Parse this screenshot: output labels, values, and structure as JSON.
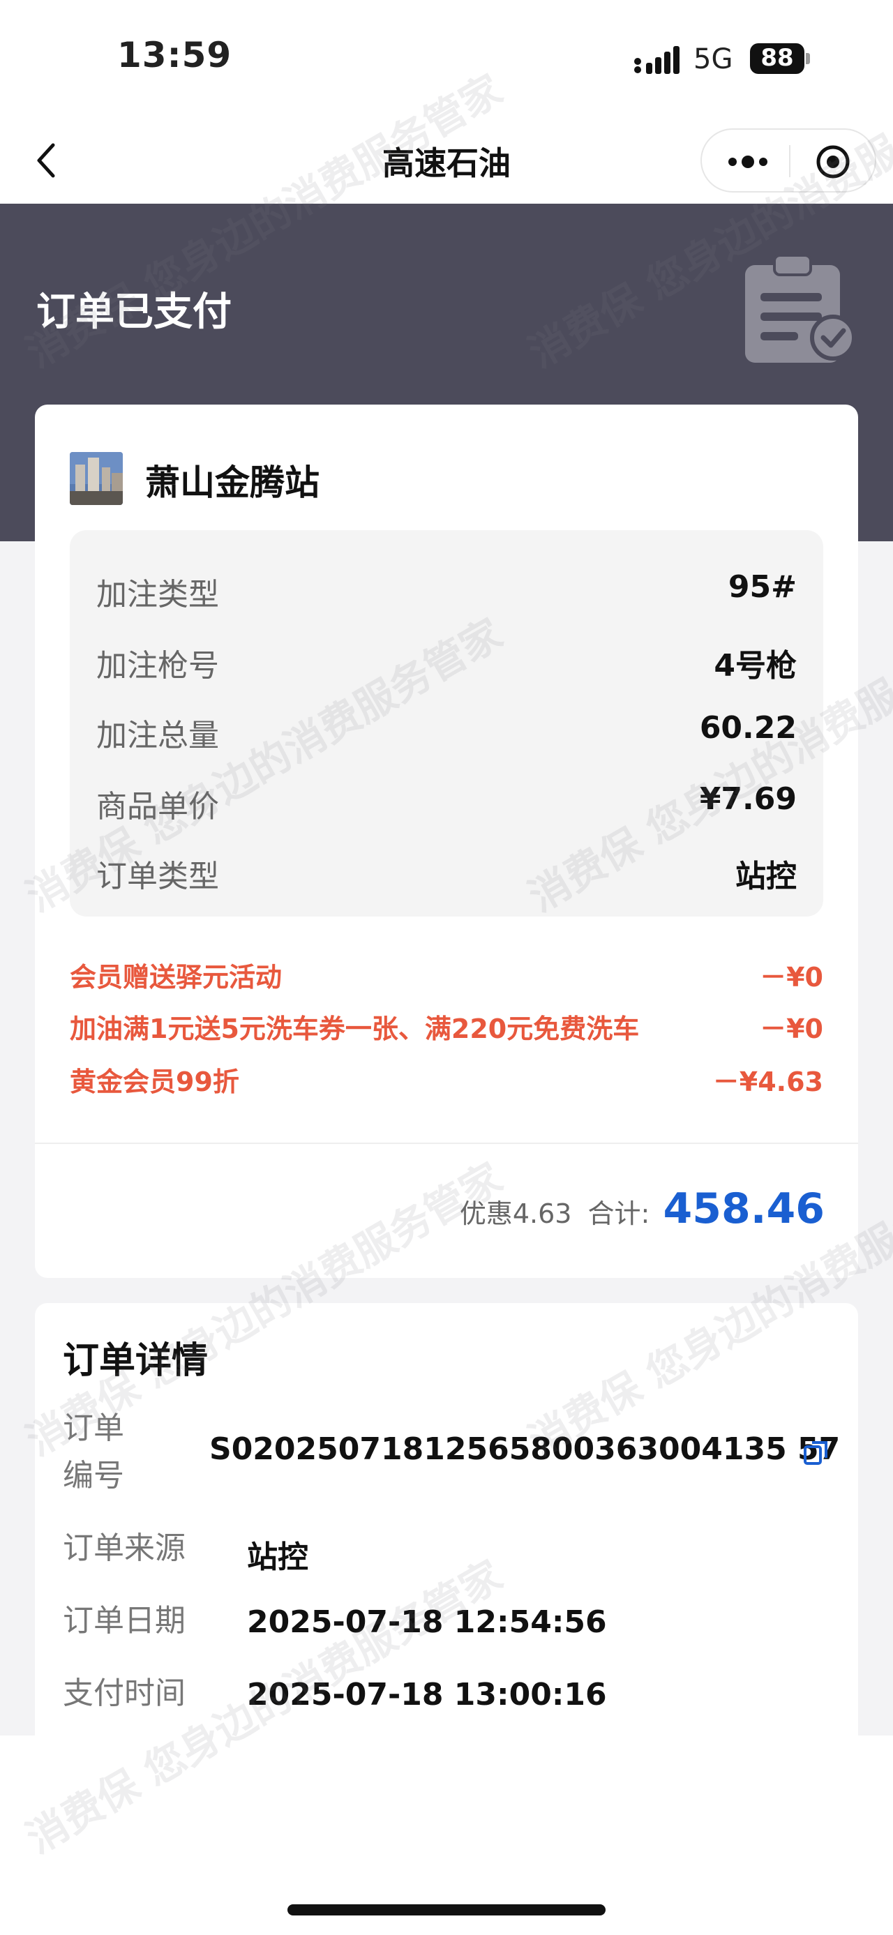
{
  "status_bar": {
    "time": "13:59",
    "network": "5G",
    "battery": "88"
  },
  "nav": {
    "title": "高速石油"
  },
  "header": {
    "status_title": "订单已支付"
  },
  "order": {
    "station_name": "萧山金腾站",
    "info_rows": [
      {
        "label": "加注类型",
        "value": "95#"
      },
      {
        "label": "加注枪号",
        "value": "4号枪"
      },
      {
        "label": "加注总量",
        "value": "60.22"
      },
      {
        "label": "商品单价",
        "value": "¥7.69"
      },
      {
        "label": "订单类型",
        "value": "站控"
      }
    ],
    "promotions": [
      {
        "label": "会员赠送驿元活动",
        "value": "－¥0"
      },
      {
        "label": "加油满1元送5元洗车券一张、满220元免费洗车",
        "value": "－¥0"
      },
      {
        "label": "黄金会员99折",
        "value": "－¥4.63"
      }
    ],
    "discount_text": "优惠4.63",
    "total_label": "合计:",
    "total_value": "458.46"
  },
  "details": {
    "title": "订单详情",
    "order_no_label": "订单编号",
    "order_no": "S02025071812565800363004135 57",
    "rows": [
      {
        "label": "订单来源",
        "value": "站控"
      },
      {
        "label": "订单日期",
        "value": "2025-07-18 12:54:56"
      },
      {
        "label": "支付时间",
        "value": "2025-07-18 13:00:16"
      }
    ]
  },
  "watermark": {
    "text": "消费保 您身边的消费服务管家"
  },
  "colors": {
    "header_bg": "#4c4b5b",
    "promo_red": "#e8583d",
    "total_blue": "#1a5fd1"
  }
}
